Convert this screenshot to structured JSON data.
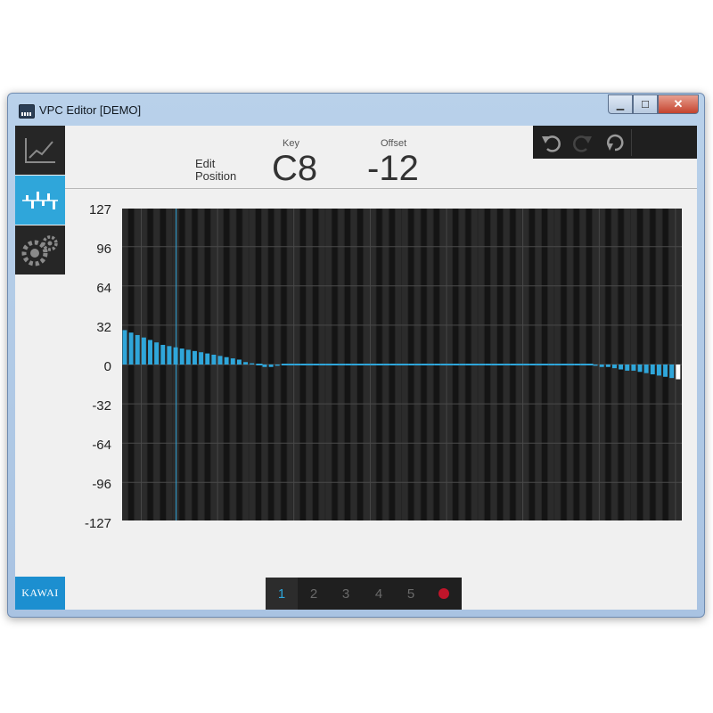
{
  "window": {
    "title": "VPC Editor [DEMO]"
  },
  "sidebar": {
    "items": [
      {
        "icon": "line-graph-icon",
        "active": false
      },
      {
        "icon": "voicing-bars-icon",
        "active": true
      },
      {
        "icon": "settings-gears-icon",
        "active": false
      }
    ],
    "logo": "KAWAI"
  },
  "header": {
    "edit_label": "Edit Position",
    "key_label": "Key",
    "key_value": "C8",
    "offset_label": "Offset",
    "offset_value": "-12"
  },
  "toolbar": {
    "undo_icon": "undo-icon",
    "redo_icon": "redo-icon",
    "reset_icon": "reset-icon"
  },
  "pages": {
    "items": [
      "1",
      "2",
      "3",
      "4",
      "5"
    ],
    "active": "1",
    "record_icon": "record-icon",
    "record_color": "#c0152a"
  },
  "colors": {
    "accent": "#2fa6da",
    "plot_bg": "#242424",
    "sidebar": "#262626"
  },
  "chart_data": {
    "type": "bar",
    "title": "",
    "xlabel": "",
    "ylabel": "",
    "ylim": [
      -127,
      127
    ],
    "y_ticks": [
      "127",
      "96",
      "64",
      "32",
      "0",
      "-32",
      "-64",
      "-96",
      "-127"
    ],
    "x_count": 88,
    "selected_key_index": 87,
    "cursor_key_index": 8,
    "values": [
      28,
      26,
      24,
      22,
      20,
      18,
      16,
      15,
      14,
      13,
      12,
      11,
      10,
      9,
      8,
      7,
      6,
      5,
      4,
      2,
      1,
      0,
      -2,
      -2,
      -1,
      0,
      0,
      0,
      0,
      0,
      0,
      0,
      0,
      0,
      0,
      0,
      0,
      0,
      0,
      0,
      0,
      0,
      0,
      0,
      0,
      0,
      0,
      0,
      0,
      0,
      0,
      0,
      0,
      0,
      0,
      0,
      0,
      0,
      0,
      0,
      0,
      0,
      0,
      0,
      0,
      0,
      0,
      0,
      0,
      0,
      0,
      0,
      0,
      0,
      -1,
      -2,
      -2,
      -3,
      -4,
      -5,
      -5,
      -6,
      -7,
      -8,
      -9,
      -10,
      -11,
      -12
    ]
  }
}
